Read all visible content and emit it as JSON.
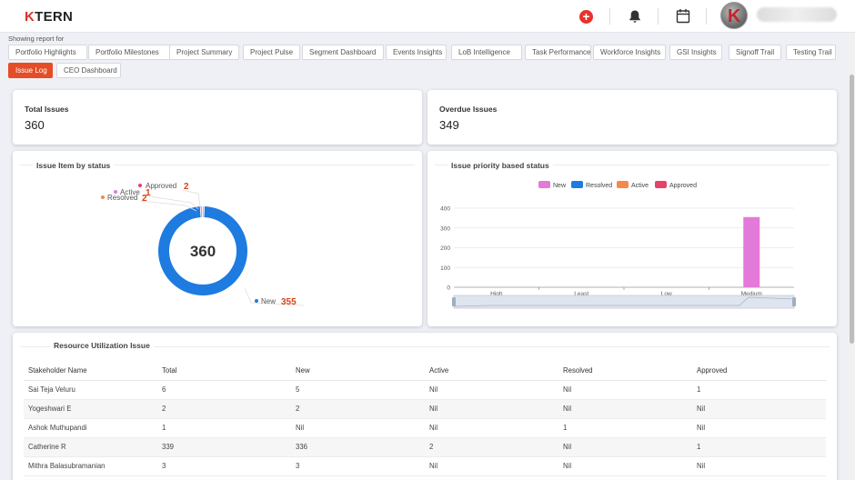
{
  "header": {
    "logo_k": "K",
    "logo_rest": "TERN",
    "add_label": "+"
  },
  "nav": {
    "label": "Showing report for",
    "chips": [
      {
        "label": "Portfolio Highlights",
        "active": false
      },
      {
        "label": "Portfolio Milestones",
        "active": false
      },
      {
        "label": "Project Summary",
        "active": false
      },
      {
        "label": "Project Pulse",
        "active": false
      },
      {
        "label": "Segment Dashboard",
        "active": false
      },
      {
        "label": "Events Insights",
        "active": false
      },
      {
        "label": "LoB Intelligence",
        "active": false
      },
      {
        "label": "Task Performance",
        "active": false
      },
      {
        "label": "Workforce Insights",
        "active": false
      },
      {
        "label": "GSI Insights",
        "active": false
      },
      {
        "label": "Signoff Trail",
        "active": false
      },
      {
        "label": "Testing Trail",
        "active": false
      },
      {
        "label": "Issue Log",
        "active": true
      },
      {
        "label": "CEO Dashboard",
        "active": false
      }
    ]
  },
  "stats": {
    "total": {
      "label": "Total Issues",
      "value": "360"
    },
    "overdue": {
      "label": "Overdue Issues",
      "value": "349"
    }
  },
  "status_chart": {
    "title": "Issue Item by status",
    "center_value": "360"
  },
  "priority_chart": {
    "title": "Issue priority based status"
  },
  "chart_data": [
    {
      "type": "pie",
      "title": "Issue Item by status",
      "center_text": "360",
      "slices": [
        {
          "name": "New",
          "value": 355,
          "color": "#1e7be0"
        },
        {
          "name": "Approved",
          "value": 2,
          "color": "#e8416a"
        },
        {
          "name": "Active",
          "value": 1,
          "color": "#e37ad9"
        },
        {
          "name": "Resolved",
          "value": 2,
          "color": "#f4894a"
        }
      ],
      "label_value_color": "#d84315"
    },
    {
      "type": "bar",
      "title": "Issue priority based status",
      "categories": [
        "High",
        "Least",
        "Low",
        "Medium"
      ],
      "series": [
        {
          "name": "New",
          "color": "#e37ad9",
          "values": [
            0,
            0,
            0,
            355
          ]
        },
        {
          "name": "Resolved",
          "color": "#1e7be0",
          "values": [
            0,
            0,
            0,
            1
          ]
        },
        {
          "name": "Active",
          "color": "#f4894a",
          "values": [
            0,
            0,
            0,
            2
          ]
        },
        {
          "name": "Approved",
          "color": "#e8416a",
          "values": [
            0,
            0,
            0,
            2
          ]
        }
      ],
      "y_ticks": [
        "0",
        "100",
        "200",
        "300",
        "400"
      ],
      "ylim": [
        0,
        400
      ],
      "legend_position": "top-center",
      "grid": true
    }
  ],
  "resource_table": {
    "title": "Resource Utilization Issue",
    "columns": [
      "Stakeholder Name",
      "Total",
      "New",
      "Active",
      "Resolved",
      "Approved"
    ],
    "rows": [
      [
        "Sai Teja Veluru",
        "6",
        "5",
        "Nil",
        "Nil",
        "1"
      ],
      [
        "Yogeshwari E",
        "2",
        "2",
        "Nil",
        "Nil",
        "Nil"
      ],
      [
        "Ashok Muthupandi",
        "1",
        "Nil",
        "Nil",
        "1",
        "Nil"
      ],
      [
        "Catherine R",
        "339",
        "336",
        "2",
        "Nil",
        "1"
      ],
      [
        "Mithra Balasubramanian",
        "3",
        "3",
        "Nil",
        "Nil",
        "Nil"
      ]
    ]
  },
  "colors": {
    "accent": "#e44d26",
    "brand_red": "#d9342b"
  }
}
